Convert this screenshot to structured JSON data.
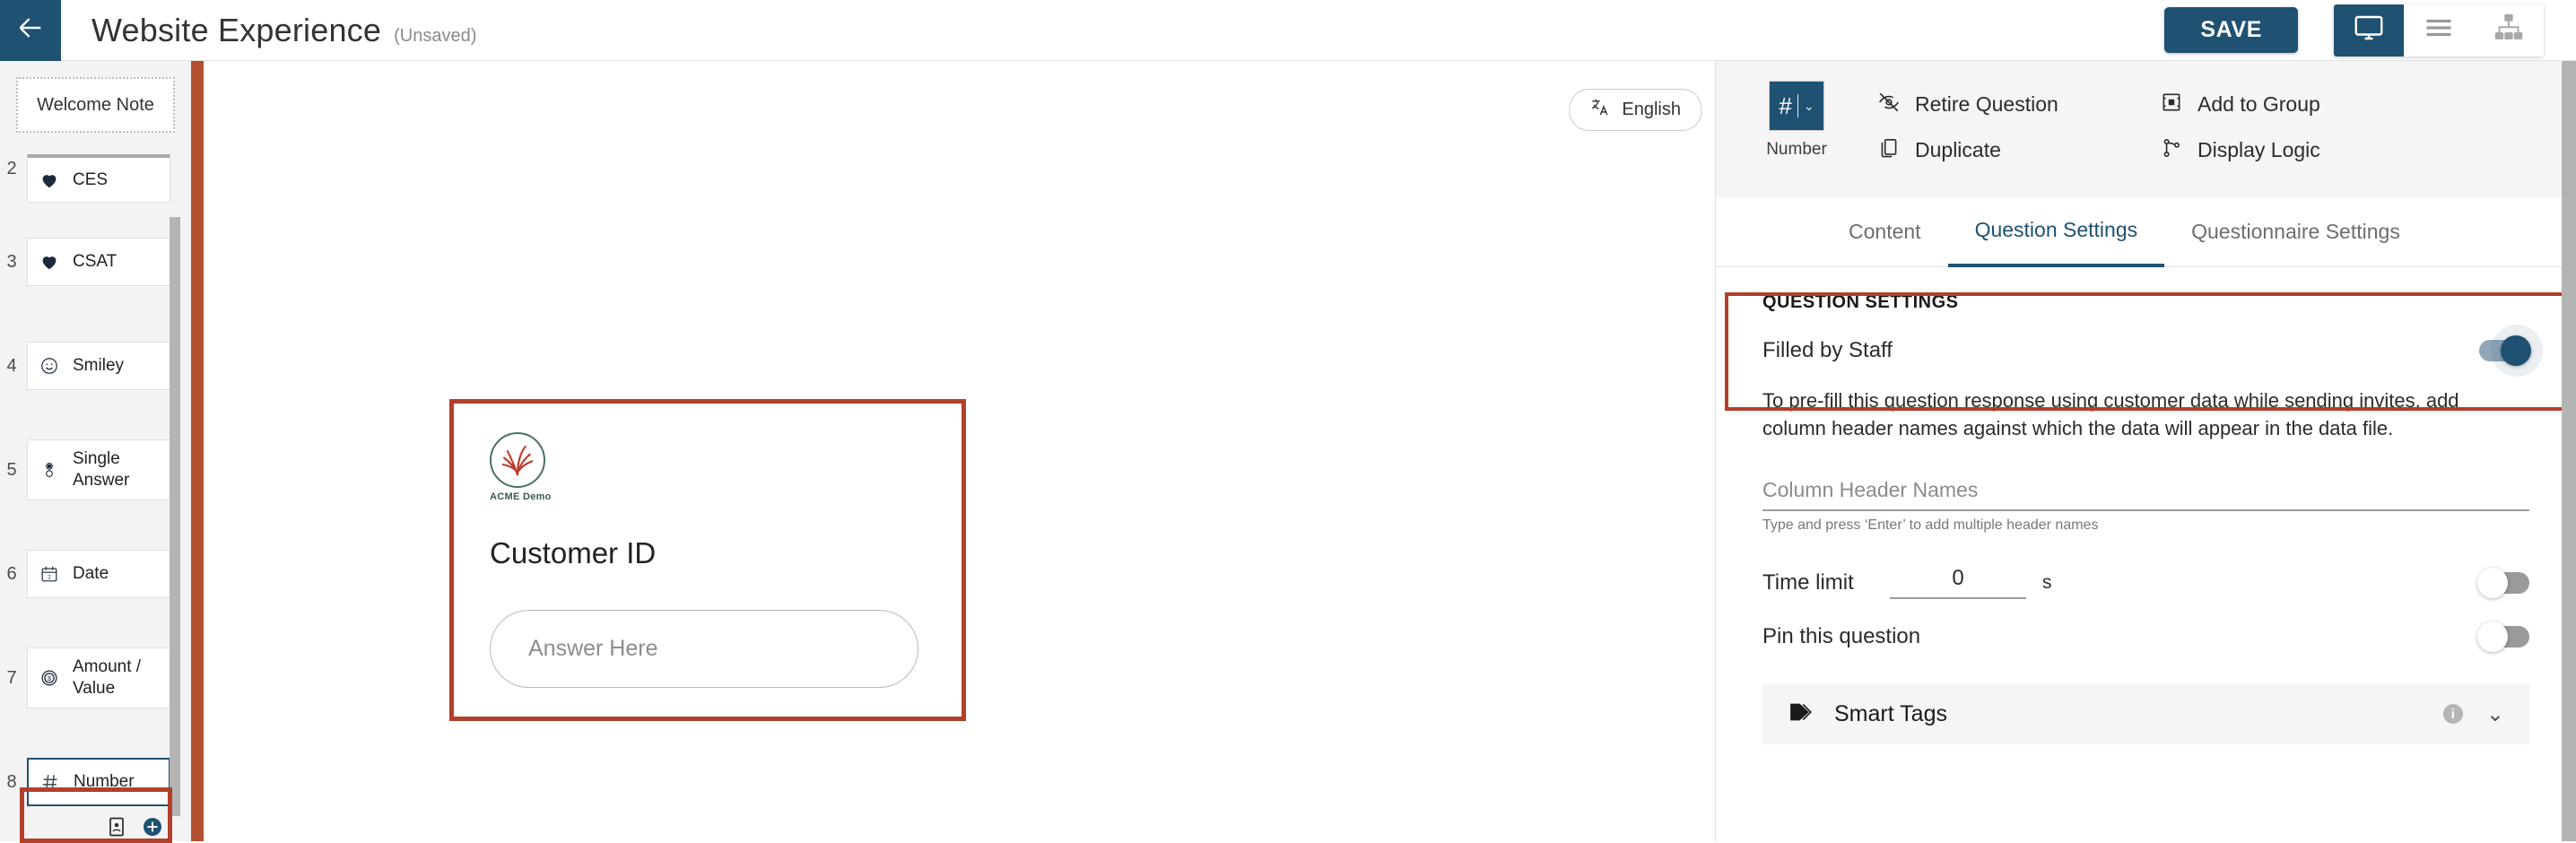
{
  "topbar": {
    "back_icon": "arrow-left-icon",
    "title": "Website Experience",
    "state": "(Unsaved)",
    "save_label": "SAVE",
    "views": [
      {
        "icon": "monitor-icon",
        "name": "desktop-view",
        "active": true
      },
      {
        "icon": "list-icon",
        "name": "list-view",
        "active": false
      },
      {
        "icon": "sitemap-icon",
        "name": "tree-view",
        "active": false
      }
    ]
  },
  "sidebar": {
    "welcome_note": "Welcome Note",
    "items": [
      {
        "num": "2",
        "label": "CES",
        "icon": "heart-icon",
        "clipped": true,
        "selected": false
      },
      {
        "num": "3",
        "label": "CSAT",
        "icon": "heart-icon",
        "clipped": false,
        "selected": false
      },
      {
        "num": "4",
        "label": "Smiley",
        "icon": "smiley-icon",
        "clipped": false,
        "selected": false
      },
      {
        "num": "5",
        "label": "Single Answer",
        "icon": "radio-icon",
        "clipped": false,
        "selected": false
      },
      {
        "num": "6",
        "label": "Date",
        "icon": "calendar-icon",
        "clipped": false,
        "selected": false
      },
      {
        "num": "7",
        "label": "Amount / Value",
        "icon": "coin-icon",
        "clipped": false,
        "selected": false
      },
      {
        "num": "8",
        "label": "Number",
        "icon": "hash-icon",
        "clipped": false,
        "selected": true
      }
    ],
    "footer": [
      {
        "name": "contact-card-icon"
      },
      {
        "name": "add-question-icon"
      }
    ]
  },
  "canvas": {
    "language": "English",
    "language_icon": "translate-icon",
    "preview": {
      "brand_name": "ACME Demo",
      "question_title": "Customer ID",
      "answer_placeholder": "Answer Here"
    }
  },
  "right_panel": {
    "question_type": {
      "symbol": "#",
      "caret": "⌄",
      "label": "Number"
    },
    "actions": [
      {
        "label": "Retire Question",
        "icon": "eye-off-icon"
      },
      {
        "label": "Add to Group",
        "icon": "group-icon"
      },
      {
        "label": "Duplicate",
        "icon": "duplicate-icon"
      },
      {
        "label": "Display Logic",
        "icon": "branch-icon"
      }
    ],
    "tabs": [
      {
        "label": "Content",
        "active": false
      },
      {
        "label": "Question Settings",
        "active": true
      },
      {
        "label": "Questionnaire Settings",
        "active": false
      }
    ],
    "settings": {
      "heading": "QUESTION SETTINGS",
      "filled_by_staff_label": "Filled by Staff",
      "filled_by_staff_state": "on",
      "description": "To pre-fill this question response using customer data while sending invites, add column header names against which the data will appear in the data file.",
      "column_header_placeholder": "Column Header Names",
      "column_header_value": "",
      "column_header_hint": "Type and press ‘Enter’ to add multiple header names",
      "time_limit_label": "Time limit",
      "time_limit_value": "0",
      "time_limit_unit": "s",
      "time_limit_state": "off",
      "pin_label": "Pin this question",
      "pin_state": "off"
    },
    "smart_tags": {
      "label": "Smart Tags",
      "icon": "tag-icon",
      "info_icon": "info-icon",
      "chevron": "⌄"
    }
  },
  "colors": {
    "brand_blue": "#1e5172",
    "highlight_red": "#b2402a",
    "strip_red": "#b2502f",
    "panel_gray": "#f5f5f5"
  }
}
